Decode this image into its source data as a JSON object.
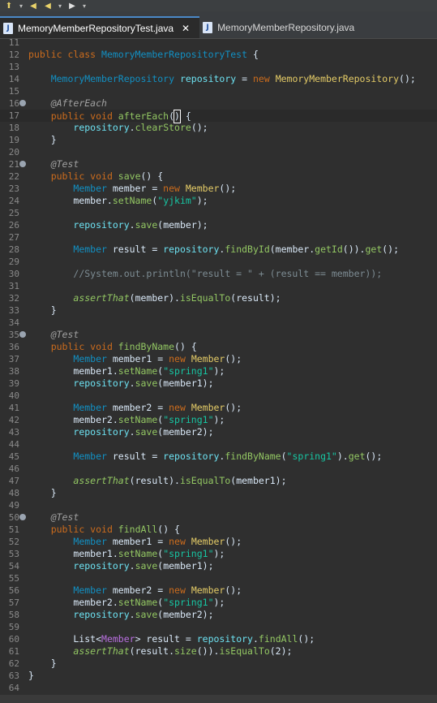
{
  "toolbar": {
    "icons": [
      "pin-icon",
      "arrow-left-icon",
      "arrow-left-icon",
      "arrow-right-icon"
    ]
  },
  "tabs": [
    {
      "label": "MemoryMemberRepositoryTest.java",
      "active": true,
      "icon": "java-file-icon"
    },
    {
      "label": "MemoryMemberRepository.java",
      "active": false,
      "icon": "java-file-icon"
    }
  ],
  "editor": {
    "lines": [
      {
        "n": 11,
        "tokens": []
      },
      {
        "n": 12,
        "tokens": [
          [
            "kw",
            "public "
          ],
          [
            "kw",
            "class "
          ],
          [
            "type",
            "MemoryMemberRepositoryTest"
          ],
          [
            "",
            " {"
          ]
        ]
      },
      {
        "n": 13,
        "tokens": []
      },
      {
        "n": 14,
        "tokens": [
          [
            "",
            "    "
          ],
          [
            "type",
            "MemoryMemberRepository "
          ],
          [
            "var",
            "repository"
          ],
          [
            "",
            " = "
          ],
          [
            "kw",
            "new "
          ],
          [
            "cls",
            "MemoryMemberRepository"
          ],
          [
            "",
            "();"
          ]
        ]
      },
      {
        "n": 15,
        "tokens": []
      },
      {
        "n": 16,
        "fold": true,
        "tokens": [
          [
            "",
            "    "
          ],
          [
            "ann",
            "@AfterEach"
          ]
        ]
      },
      {
        "n": 17,
        "current": true,
        "tokens": [
          [
            "",
            "    "
          ],
          [
            "kw",
            "public "
          ],
          [
            "kw",
            "void "
          ],
          [
            "fn",
            "afterEach"
          ],
          [
            "caret",
            "()"
          ],
          [
            "",
            " {"
          ]
        ]
      },
      {
        "n": 18,
        "tokens": [
          [
            "",
            "        "
          ],
          [
            "var",
            "repository"
          ],
          [
            "",
            "."
          ],
          [
            "fn",
            "clearStore"
          ],
          [
            "",
            "();"
          ]
        ]
      },
      {
        "n": 19,
        "tokens": [
          [
            "",
            "    }"
          ]
        ]
      },
      {
        "n": 20,
        "tokens": []
      },
      {
        "n": 21,
        "fold": true,
        "tokens": [
          [
            "",
            "    "
          ],
          [
            "ann",
            "@Test"
          ]
        ]
      },
      {
        "n": 22,
        "tokens": [
          [
            "",
            "    "
          ],
          [
            "kw",
            "public "
          ],
          [
            "kw",
            "void "
          ],
          [
            "fn",
            "save"
          ],
          [
            "",
            "() {"
          ]
        ]
      },
      {
        "n": 23,
        "tokens": [
          [
            "",
            "        "
          ],
          [
            "type",
            "Member "
          ],
          [
            "",
            "member = "
          ],
          [
            "kw",
            "new "
          ],
          [
            "cls",
            "Member"
          ],
          [
            "",
            "();"
          ]
        ]
      },
      {
        "n": 24,
        "tokens": [
          [
            "",
            "        member."
          ],
          [
            "fn",
            "setName"
          ],
          [
            "",
            "("
          ],
          [
            "str",
            "\"yjkim\""
          ],
          [
            "",
            ");"
          ]
        ]
      },
      {
        "n": 25,
        "tokens": []
      },
      {
        "n": 26,
        "tokens": [
          [
            "",
            "        "
          ],
          [
            "var",
            "repository"
          ],
          [
            "",
            "."
          ],
          [
            "fn",
            "save"
          ],
          [
            "",
            "(member);"
          ]
        ]
      },
      {
        "n": 27,
        "tokens": []
      },
      {
        "n": 28,
        "tokens": [
          [
            "",
            "        "
          ],
          [
            "type",
            "Member "
          ],
          [
            "",
            "result = "
          ],
          [
            "var",
            "repository"
          ],
          [
            "",
            "."
          ],
          [
            "fn",
            "findById"
          ],
          [
            "",
            "(member."
          ],
          [
            "fn",
            "getId"
          ],
          [
            "",
            "())."
          ],
          [
            "fn",
            "get"
          ],
          [
            "",
            "();"
          ]
        ]
      },
      {
        "n": 29,
        "tokens": []
      },
      {
        "n": 30,
        "tokens": [
          [
            "",
            "        "
          ],
          [
            "cmt",
            "//System.out.println(\"result = \" + (result == member));"
          ]
        ]
      },
      {
        "n": 31,
        "tokens": []
      },
      {
        "n": 32,
        "tokens": [
          [
            "",
            "        "
          ],
          [
            "fnit",
            "assertThat"
          ],
          [
            "",
            "(member)."
          ],
          [
            "fn",
            "isEqualTo"
          ],
          [
            "",
            "(result);"
          ]
        ]
      },
      {
        "n": 33,
        "tokens": [
          [
            "",
            "    }"
          ]
        ]
      },
      {
        "n": 34,
        "tokens": []
      },
      {
        "n": 35,
        "fold": true,
        "tokens": [
          [
            "",
            "    "
          ],
          [
            "ann",
            "@Test"
          ]
        ]
      },
      {
        "n": 36,
        "tokens": [
          [
            "",
            "    "
          ],
          [
            "kw",
            "public "
          ],
          [
            "kw",
            "void "
          ],
          [
            "fn",
            "findByName"
          ],
          [
            "",
            "() {"
          ]
        ]
      },
      {
        "n": 37,
        "tokens": [
          [
            "",
            "        "
          ],
          [
            "type",
            "Member "
          ],
          [
            "",
            "member1 = "
          ],
          [
            "kw",
            "new "
          ],
          [
            "cls",
            "Member"
          ],
          [
            "",
            "();"
          ]
        ]
      },
      {
        "n": 38,
        "tokens": [
          [
            "",
            "        member1."
          ],
          [
            "fn",
            "setName"
          ],
          [
            "",
            "("
          ],
          [
            "str",
            "\"spring1\""
          ],
          [
            "",
            ");"
          ]
        ]
      },
      {
        "n": 39,
        "tokens": [
          [
            "",
            "        "
          ],
          [
            "var",
            "repository"
          ],
          [
            "",
            "."
          ],
          [
            "fn",
            "save"
          ],
          [
            "",
            "(member1);"
          ]
        ]
      },
      {
        "n": 40,
        "tokens": []
      },
      {
        "n": 41,
        "tokens": [
          [
            "",
            "        "
          ],
          [
            "type",
            "Member "
          ],
          [
            "",
            "member2 = "
          ],
          [
            "kw",
            "new "
          ],
          [
            "cls",
            "Member"
          ],
          [
            "",
            "();"
          ]
        ]
      },
      {
        "n": 42,
        "tokens": [
          [
            "",
            "        member2."
          ],
          [
            "fn",
            "setName"
          ],
          [
            "",
            "("
          ],
          [
            "str",
            "\"spring1\""
          ],
          [
            "",
            ");"
          ]
        ]
      },
      {
        "n": 43,
        "tokens": [
          [
            "",
            "        "
          ],
          [
            "var",
            "repository"
          ],
          [
            "",
            "."
          ],
          [
            "fn",
            "save"
          ],
          [
            "",
            "(member2);"
          ]
        ]
      },
      {
        "n": 44,
        "tokens": []
      },
      {
        "n": 45,
        "tokens": [
          [
            "",
            "        "
          ],
          [
            "type",
            "Member "
          ],
          [
            "",
            "result = "
          ],
          [
            "var",
            "repository"
          ],
          [
            "",
            "."
          ],
          [
            "fn",
            "findByName"
          ],
          [
            "",
            "("
          ],
          [
            "str",
            "\"spring1\""
          ],
          [
            "",
            ")."
          ],
          [
            "fn",
            "get"
          ],
          [
            "",
            "();"
          ]
        ]
      },
      {
        "n": 46,
        "tokens": []
      },
      {
        "n": 47,
        "tokens": [
          [
            "",
            "        "
          ],
          [
            "fnit",
            "assertThat"
          ],
          [
            "",
            "(result)."
          ],
          [
            "fn",
            "isEqualTo"
          ],
          [
            "",
            "(member1);"
          ]
        ]
      },
      {
        "n": 48,
        "tokens": [
          [
            "",
            "    }"
          ]
        ]
      },
      {
        "n": 49,
        "tokens": []
      },
      {
        "n": 50,
        "fold": true,
        "tokens": [
          [
            "",
            "    "
          ],
          [
            "ann",
            "@Test"
          ]
        ]
      },
      {
        "n": 51,
        "tokens": [
          [
            "",
            "    "
          ],
          [
            "kw",
            "public "
          ],
          [
            "kw",
            "void "
          ],
          [
            "fn",
            "findAll"
          ],
          [
            "",
            "() {"
          ]
        ]
      },
      {
        "n": 52,
        "tokens": [
          [
            "",
            "        "
          ],
          [
            "type",
            "Member "
          ],
          [
            "",
            "member1 = "
          ],
          [
            "kw",
            "new "
          ],
          [
            "cls",
            "Member"
          ],
          [
            "",
            "();"
          ]
        ]
      },
      {
        "n": 53,
        "tokens": [
          [
            "",
            "        member1."
          ],
          [
            "fn",
            "setName"
          ],
          [
            "",
            "("
          ],
          [
            "str",
            "\"spring1\""
          ],
          [
            "",
            ");"
          ]
        ]
      },
      {
        "n": 54,
        "tokens": [
          [
            "",
            "        "
          ],
          [
            "var",
            "repository"
          ],
          [
            "",
            "."
          ],
          [
            "fn",
            "save"
          ],
          [
            "",
            "(member1);"
          ]
        ]
      },
      {
        "n": 55,
        "tokens": []
      },
      {
        "n": 56,
        "tokens": [
          [
            "",
            "        "
          ],
          [
            "type",
            "Member "
          ],
          [
            "",
            "member2 = "
          ],
          [
            "kw",
            "new "
          ],
          [
            "cls",
            "Member"
          ],
          [
            "",
            "();"
          ]
        ]
      },
      {
        "n": 57,
        "tokens": [
          [
            "",
            "        member2."
          ],
          [
            "fn",
            "setName"
          ],
          [
            "",
            "("
          ],
          [
            "str",
            "\"spring1\""
          ],
          [
            "",
            ");"
          ]
        ]
      },
      {
        "n": 58,
        "tokens": [
          [
            "",
            "        "
          ],
          [
            "var",
            "repository"
          ],
          [
            "",
            "."
          ],
          [
            "fn",
            "save"
          ],
          [
            "",
            "(member2);"
          ]
        ]
      },
      {
        "n": 59,
        "tokens": []
      },
      {
        "n": 60,
        "tokens": [
          [
            "",
            "        List<"
          ],
          [
            "generic",
            "Member"
          ],
          [
            "",
            "> result = "
          ],
          [
            "var",
            "repository"
          ],
          [
            "",
            "."
          ],
          [
            "fn",
            "findAll"
          ],
          [
            "",
            "();"
          ]
        ]
      },
      {
        "n": 61,
        "tokens": [
          [
            "",
            "        "
          ],
          [
            "fnit",
            "assertThat"
          ],
          [
            "",
            "(result."
          ],
          [
            "fn",
            "size"
          ],
          [
            "",
            "())."
          ],
          [
            "fn",
            "isEqualTo"
          ],
          [
            "",
            "(2);"
          ]
        ]
      },
      {
        "n": 62,
        "tokens": [
          [
            "",
            "    }"
          ]
        ]
      },
      {
        "n": 63,
        "tokens": [
          [
            "",
            "}"
          ]
        ]
      },
      {
        "n": 64,
        "tokens": []
      }
    ]
  }
}
